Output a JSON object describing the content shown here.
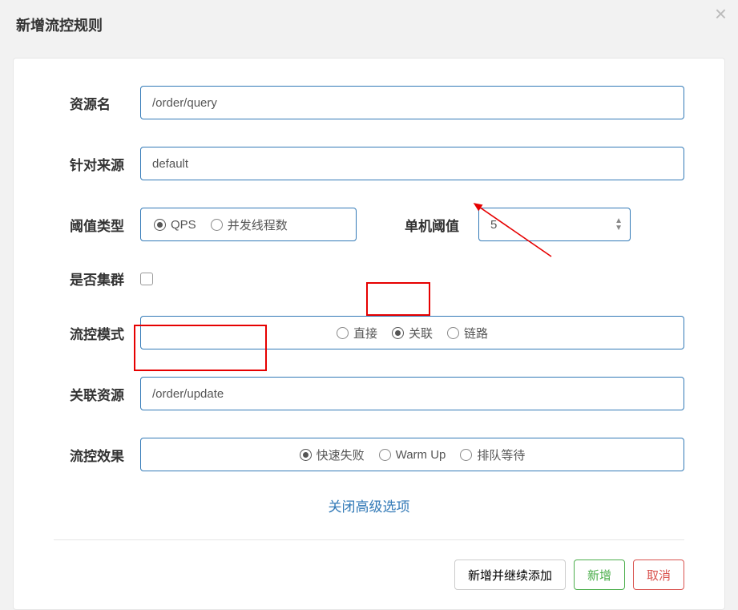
{
  "modal": {
    "title": "新增流控规则"
  },
  "form": {
    "resource": {
      "label": "资源名",
      "value": "/order/query"
    },
    "source": {
      "label": "针对来源",
      "value": "default"
    },
    "thresholdType": {
      "label": "阈值类型",
      "options": {
        "qps": "QPS",
        "thread": "并发线程数"
      },
      "selected": "qps"
    },
    "threshold": {
      "label": "单机阈值",
      "value": "5"
    },
    "cluster": {
      "label": "是否集群",
      "checked": false
    },
    "mode": {
      "label": "流控模式",
      "options": {
        "direct": "直接",
        "relate": "关联",
        "chain": "链路"
      },
      "selected": "relate"
    },
    "related": {
      "label": "关联资源",
      "value": "/order/update"
    },
    "effect": {
      "label": "流控效果",
      "options": {
        "fastfail": "快速失败",
        "warmup": "Warm Up",
        "queue": "排队等待"
      },
      "selected": "fastfail"
    }
  },
  "link": {
    "closeAdvanced": "关闭高级选项"
  },
  "footer": {
    "addContinue": "新增并继续添加",
    "add": "新增",
    "cancel": "取消"
  }
}
